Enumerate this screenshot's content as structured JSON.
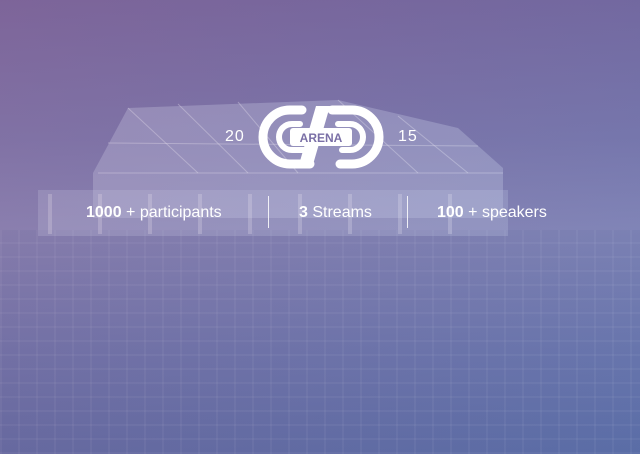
{
  "logo": {
    "text": "ARENA",
    "year_left": "20",
    "year_right": "15"
  },
  "stats": [
    {
      "number": "1000",
      "label": "+ participants"
    },
    {
      "number": "3",
      "label": "Streams"
    },
    {
      "number": "100",
      "label": "+ speakers"
    }
  ],
  "colors": {
    "text": "#ffffff",
    "overlay_left": "#7b6a9c",
    "overlay_right": "#5f78b0"
  }
}
